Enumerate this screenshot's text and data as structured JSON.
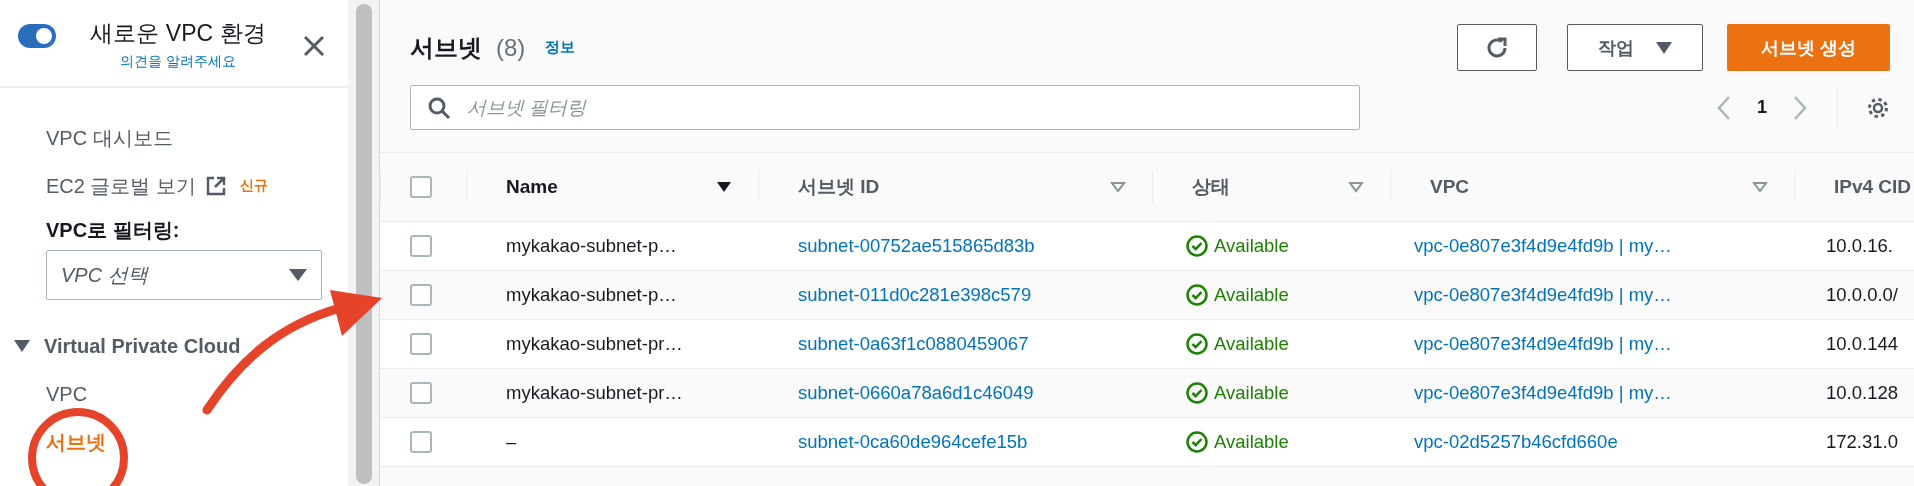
{
  "sidebar": {
    "new_experience": {
      "label": "새로운 VPC 환경",
      "on": true,
      "feedback_link": "의견을 알려주세요"
    },
    "items": [
      {
        "label": "VPC 대시보드",
        "kind": "link"
      },
      {
        "label": "EC2 글로벌 보기",
        "kind": "external",
        "badge": "신규"
      }
    ],
    "filter": {
      "label": "VPC로 필터링:",
      "placeholder": "VPC 선택"
    },
    "sections": [
      {
        "label": "Virtual Private Cloud",
        "expanded": true,
        "children": [
          {
            "label": "VPC",
            "selected": false
          },
          {
            "label": "서브넷",
            "selected": true
          }
        ]
      }
    ]
  },
  "main": {
    "title": "서브넷",
    "count": "(8)",
    "info_link": "정보",
    "actions_button": "작업",
    "create_button": "서브넷 생성",
    "search": {
      "placeholder": "서브넷 필터링"
    },
    "page": "1",
    "table": {
      "all_checked": false,
      "columns": [
        {
          "label": "Name",
          "sorted": true
        },
        {
          "label": "서브넷 ID",
          "sorted": false
        },
        {
          "label": "상태",
          "sorted": false
        },
        {
          "label": "VPC",
          "sorted": false
        },
        {
          "label": "IPv4 CID"
        }
      ],
      "rows": [
        {
          "checked": false,
          "name": "mykakao-subnet-p…",
          "subnet_id": "subnet-00752ae515865d83b",
          "status": "Available",
          "vpc": "vpc-0e807e3f4d9e4fd9b | my…",
          "cidr": "10.0.16."
        },
        {
          "checked": false,
          "name": "mykakao-subnet-p…",
          "subnet_id": "subnet-011d0c281e398c579",
          "status": "Available",
          "vpc": "vpc-0e807e3f4d9e4fd9b | my…",
          "cidr": "10.0.0.0/"
        },
        {
          "checked": false,
          "name": "mykakao-subnet-pr…",
          "subnet_id": "subnet-0a63f1c0880459067",
          "status": "Available",
          "vpc": "vpc-0e807e3f4d9e4fd9b | my…",
          "cidr": "10.0.144"
        },
        {
          "checked": false,
          "name": "mykakao-subnet-pr…",
          "subnet_id": "subnet-0660a78a6d1c46049",
          "status": "Available",
          "vpc": "vpc-0e807e3f4d9e4fd9b | my…",
          "cidr": "10.0.128"
        },
        {
          "checked": false,
          "name": "–",
          "subnet_id": "subnet-0ca60de964cefe15b",
          "status": "Available",
          "vpc": "vpc-02d5257b46cfd660e",
          "cidr": "172.31.0"
        }
      ]
    }
  }
}
